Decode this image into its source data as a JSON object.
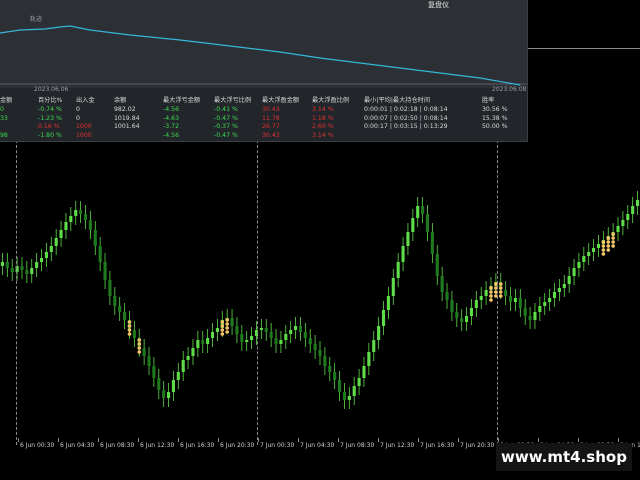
{
  "header": {
    "title": "复盘仪"
  },
  "curve": {
    "label": "轨迹",
    "date_start": "2023.06.06",
    "date_end": "2023.06.08",
    "line_color": "#35b6d8"
  },
  "stats": {
    "headers": [
      "金额",
      "百分比%",
      "出入金",
      "余额",
      "最大浮亏金额",
      "最大浮亏比例",
      "最大浮盈金额",
      "最大浮盈比例",
      "最小|平均|最大持仓时间",
      "胜率"
    ],
    "rows": [
      {
        "c0": "0",
        "c1": "-0.74 %",
        "c2": "0",
        "c3": "982.02",
        "c4": "-4.56",
        "c5": "-0.41 %",
        "c6": "30.43",
        "c7": "3.14 %",
        "c8": "0:00:01 | 0:02:18 | 0:08:14",
        "c9": "30.56 %",
        "colors": [
          "g",
          "g",
          "w",
          "w",
          "g",
          "g",
          "r",
          "r",
          "w",
          "w"
        ]
      },
      {
        "c0": "33",
        "c1": "-1.23 %",
        "c2": "0",
        "c3": "1019.84",
        "c4": "-4.63",
        "c5": "-0.47 %",
        "c6": "11.78",
        "c7": "1.18 %",
        "c8": "0:00:07 | 0:02:50 | 0:08:14",
        "c9": "15.38 %",
        "colors": [
          "g",
          "g",
          "w",
          "w",
          "g",
          "g",
          "r",
          "r",
          "w",
          "w"
        ]
      },
      {
        "c0": "",
        "c1": "0.16 %",
        "c2": "1000",
        "c3": "1001.64",
        "c4": "-3.72",
        "c5": "-0.37 %",
        "c6": "26.77",
        "c7": "2.60 %",
        "c8": "0:00:17 | 0:03:15 | 0:13:29",
        "c9": "50.00 %",
        "colors": [
          "r",
          "r",
          "r",
          "w",
          "g",
          "g",
          "r",
          "r",
          "w",
          "w"
        ]
      },
      {
        "c0": "98",
        "c1": "-1.80 %",
        "c2": "1000",
        "c3": "",
        "c4": "-4.56",
        "c5": "-0.47 %",
        "c6": "30.43",
        "c7": "3.14 %",
        "c8": "",
        "c9": "",
        "colors": [
          "g",
          "g",
          "r",
          "w",
          "g",
          "g",
          "r",
          "r",
          "w",
          "w"
        ]
      }
    ]
  },
  "time_axis": {
    "labels": [
      "6 Jun 00:30",
      "6 Jun 04:30",
      "6 Jun 08:30",
      "6 Jun 12:30",
      "6 Jun 16:30",
      "6 Jun 20:30",
      "7 Jun 00:30",
      "7 Jun 04:30",
      "7 Jun 08:30",
      "7 Jun 12:30",
      "7 Jun 16:30",
      "7 Jun 20:30",
      "8 Jun 00:30",
      "8 Jun 04:30",
      "8 Jun 08:30",
      "8 Jun 12:30"
    ]
  },
  "candles": {
    "up_color": "#5fdc4a",
    "down_color": "#1f7a1f",
    "marker_color": "#f5c46a",
    "closes": [
      262,
      268,
      272,
      266,
      270,
      274,
      268,
      262,
      258,
      252,
      246,
      238,
      230,
      222,
      216,
      210,
      214,
      220,
      230,
      246,
      262,
      280,
      296,
      306,
      312,
      320,
      330,
      338,
      348,
      356,
      366,
      378,
      390,
      398,
      392,
      380,
      372,
      360,
      356,
      348,
      340,
      344,
      338,
      332,
      328,
      320,
      318,
      326,
      334,
      342,
      340,
      336,
      330,
      328,
      332,
      338,
      344,
      340,
      334,
      330,
      326,
      332,
      338,
      344,
      350,
      356,
      366,
      372,
      380,
      392,
      400,
      396,
      386,
      378,
      366,
      352,
      340,
      326,
      310,
      296,
      278,
      262,
      246,
      232,
      218,
      206,
      214,
      232,
      254,
      276,
      292,
      300,
      312,
      318,
      322,
      316,
      308,
      300,
      296,
      290,
      286,
      282,
      290,
      296,
      302,
      298,
      308,
      316,
      320,
      312,
      306,
      302,
      298,
      292,
      288,
      284,
      276,
      268,
      262,
      256,
      252,
      248,
      244,
      240,
      236,
      232,
      226,
      220,
      214,
      206,
      200
    ],
    "markers": [
      26,
      28,
      45,
      46,
      100,
      101,
      102,
      123,
      124,
      125
    ]
  },
  "watermark": {
    "text": "www.mt4.shop"
  }
}
